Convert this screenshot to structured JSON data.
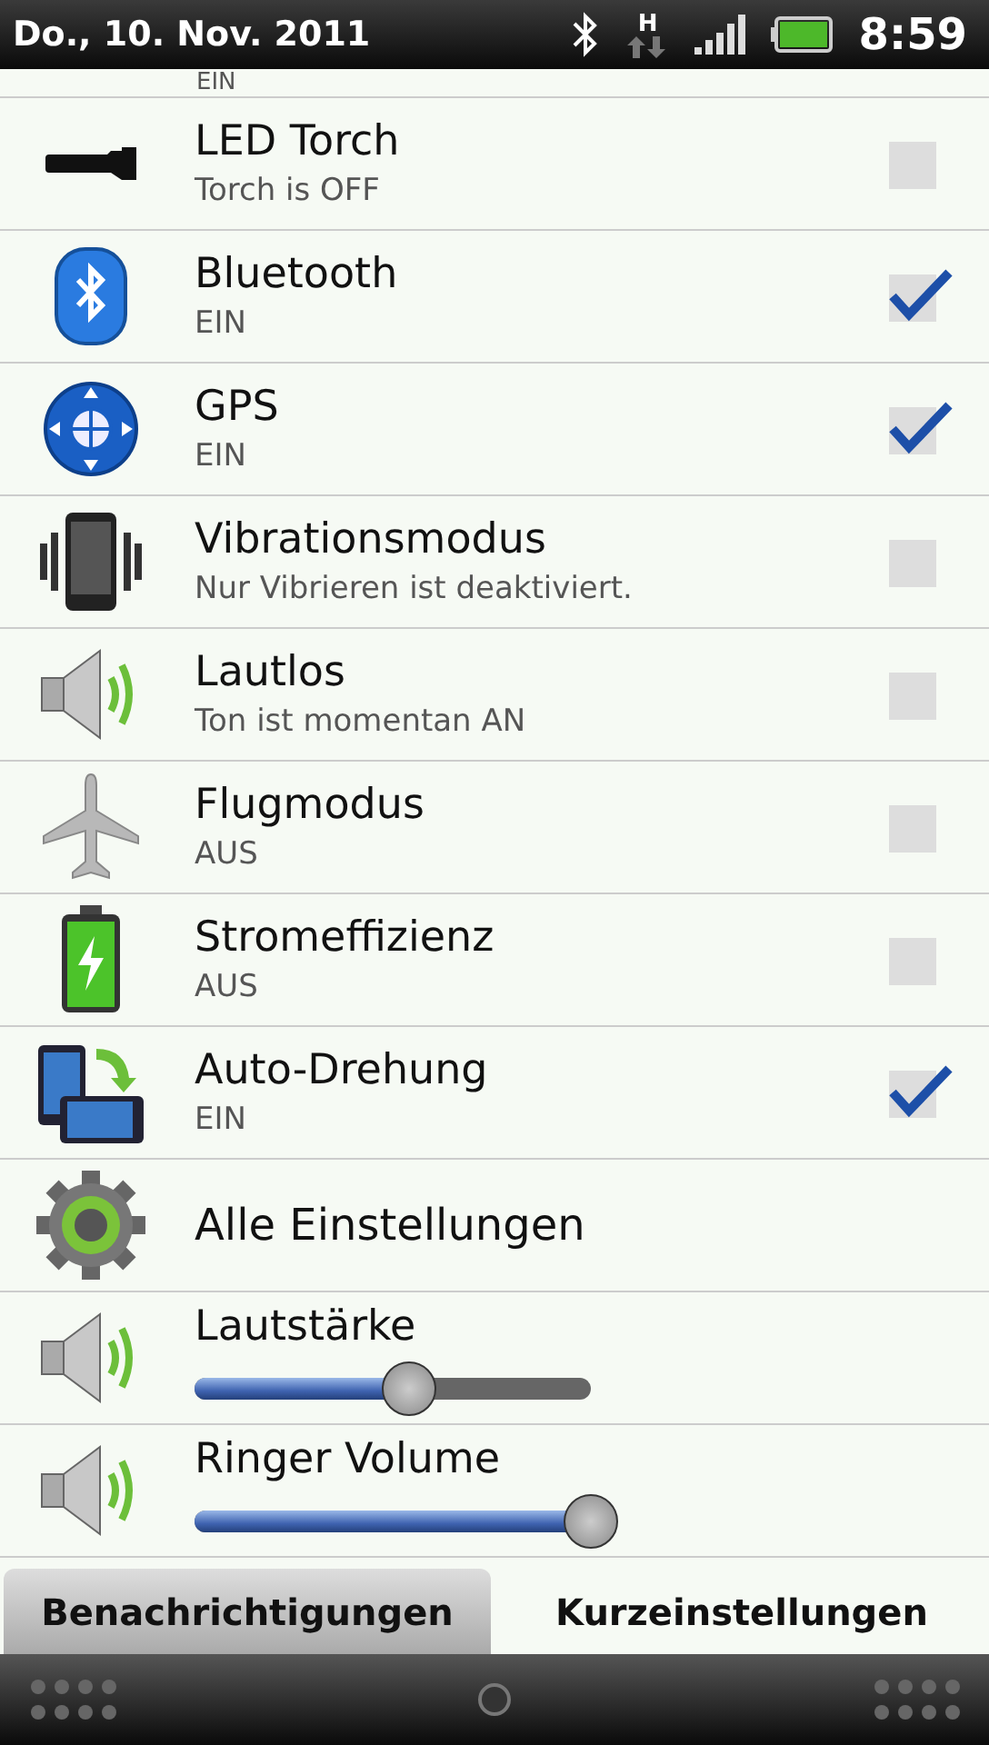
{
  "status_bar": {
    "date": "Do., 10. Nov. 2011",
    "network": "H",
    "time": "8:59"
  },
  "partial_row": {
    "subtitle": "EIN"
  },
  "rows": [
    {
      "kind": "toggle",
      "title": "LED Torch",
      "subtitle": "Torch is OFF",
      "checked": false
    },
    {
      "kind": "toggle",
      "title": "Bluetooth",
      "subtitle": "EIN",
      "checked": true
    },
    {
      "kind": "toggle",
      "title": "GPS",
      "subtitle": "EIN",
      "checked": true
    },
    {
      "kind": "toggle",
      "title": "Vibrationsmodus",
      "subtitle": "Nur Vibrieren ist deaktiviert.",
      "checked": false
    },
    {
      "kind": "toggle",
      "title": "Lautlos",
      "subtitle": "Ton ist momentan AN",
      "checked": false
    },
    {
      "kind": "toggle",
      "title": "Flugmodus",
      "subtitle": "AUS",
      "checked": false
    },
    {
      "kind": "toggle",
      "title": "Stromeffizienz",
      "subtitle": "AUS",
      "checked": false
    },
    {
      "kind": "toggle",
      "title": "Auto-Drehung",
      "subtitle": "EIN",
      "checked": true
    },
    {
      "kind": "link",
      "title": "Alle Einstellungen"
    },
    {
      "kind": "slider",
      "title": "Lautstärke",
      "level": 0.54
    },
    {
      "kind": "slider",
      "title": "Ringer Volume",
      "level": 1.0
    }
  ],
  "tabs": [
    {
      "label": "Benachrichtigungen",
      "selected": false
    },
    {
      "label": "Kurzeinstellungen",
      "selected": true
    }
  ]
}
